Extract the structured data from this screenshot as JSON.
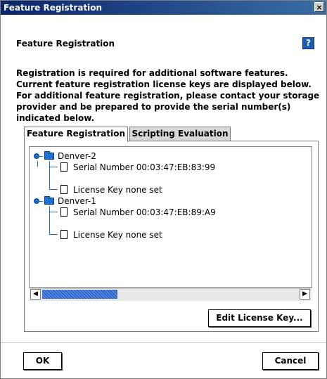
{
  "window": {
    "title": "Feature Registration",
    "close_label": "×"
  },
  "header": {
    "title": "Feature Registration",
    "help_label": "?"
  },
  "description": "Registration is required for additional software features. Current feature registration license keys are displayed below. For additional feature registration, please contact your storage provider and be prepared to provide the serial number(s) indicated below.",
  "tabs": [
    {
      "label": "Feature Registration",
      "selected": true
    },
    {
      "label": "Scripting Evaluation",
      "selected": false
    }
  ],
  "tree": [
    {
      "label": "Denver-2",
      "expanded": true,
      "children": [
        {
          "label": "Serial Number 00:03:47:EB:83:99"
        },
        {
          "label": "License Key none set"
        }
      ]
    },
    {
      "label": "Denver-1",
      "expanded": true,
      "children": [
        {
          "label": "Serial Number 00:03:47:EB:89:A9"
        },
        {
          "label": "License Key none set"
        }
      ]
    }
  ],
  "scrollbar": {
    "left_arrow": "◀",
    "right_arrow": "▶"
  },
  "buttons": {
    "edit_license_key": "Edit License Key...",
    "ok": "OK",
    "cancel": "Cancel"
  },
  "colors": {
    "titlebar": "#0a246a",
    "accent": "#1b6fd6",
    "scroll_thumb": "#2d64c8"
  }
}
